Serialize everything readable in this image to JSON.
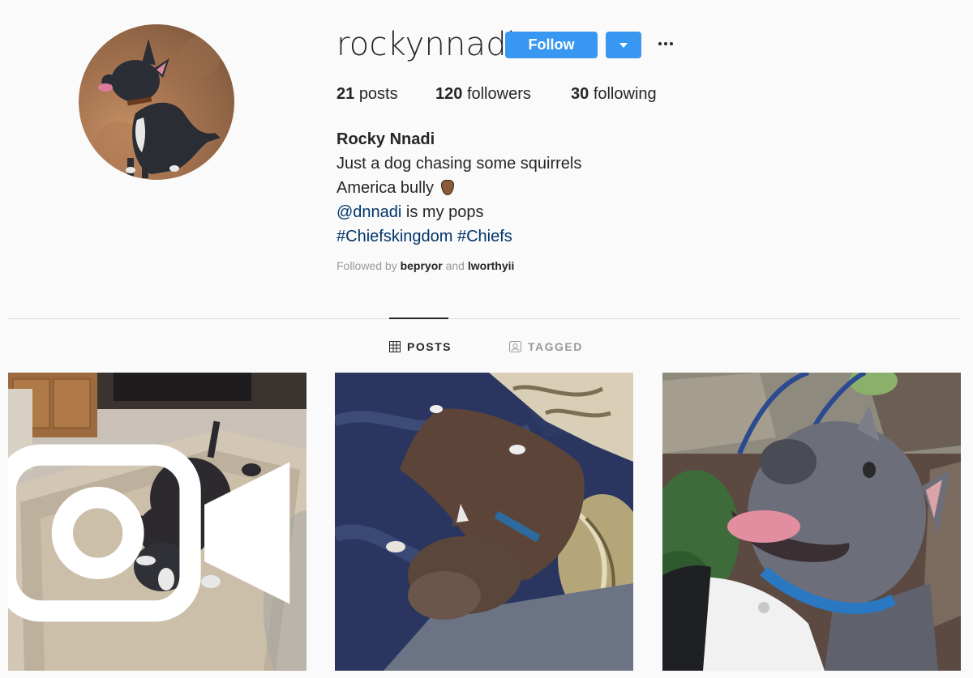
{
  "profile": {
    "username": "rockynnadi",
    "follow_label": "Follow",
    "stats": {
      "posts_count": "21",
      "posts_label": "posts",
      "followers_count": "120",
      "followers_label": "followers",
      "following_count": "30",
      "following_label": "following"
    },
    "bio": {
      "full_name": "Rocky Nnadi",
      "line1": "Just a dog chasing some squirrels",
      "line2": "America bully",
      "line3_mention": "@dnnadi",
      "line3_rest": " is my pops",
      "line4_tag1": "#Chiefskingdom",
      "line4_tag2": "#Chiefs"
    },
    "followed_by": {
      "prefix": "Followed by ",
      "user1": "bepryor",
      "conj": " and ",
      "user2": "lworthyii"
    }
  },
  "tabs": [
    {
      "label": "POSTS",
      "icon": "grid-icon",
      "active": true
    },
    {
      "label": "TAGGED",
      "icon": "tagged-icon",
      "active": false
    }
  ],
  "posts": [
    {
      "description": "dog playing on rug",
      "type": "video"
    },
    {
      "description": "dog sleeping on bed",
      "type": "photo"
    },
    {
      "description": "dog selfie smiling",
      "type": "photo"
    }
  ],
  "colors": {
    "accent": "#3897f0",
    "link": "#003569",
    "background": "#fafafa",
    "text": "#262626",
    "muted": "#999999"
  }
}
